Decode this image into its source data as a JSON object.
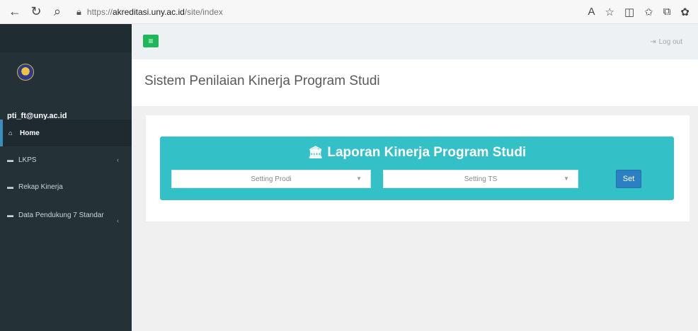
{
  "browser": {
    "url_protocol": "https://",
    "url_host": "akreditasi.uny.ac.id",
    "url_path": "/site/index",
    "icons": [
      "back-arrow-icon",
      "refresh-icon",
      "search-icon",
      "lock-icon",
      "read-aloud-icon",
      "favorite-icon",
      "split-screen-icon",
      "favorites-list-icon",
      "collections-icon",
      "extension-icon"
    ]
  },
  "sidebar": {
    "user_name": "pti_ft@uny.ac.id",
    "items": [
      {
        "label": "Home",
        "icon": "home-icon",
        "active": true
      },
      {
        "label": "LKPS",
        "icon": "briefcase-icon",
        "has_submenu": true
      },
      {
        "label": "Rekap Kinerja",
        "icon": "briefcase-icon"
      },
      {
        "label": "Data Pendukung 7 Standar",
        "icon": "briefcase-icon",
        "has_submenu": true
      }
    ]
  },
  "topbar": {
    "logout_label": "Log out"
  },
  "page": {
    "title": "Sistem Penilaian Kinerja Program Studi"
  },
  "banner": {
    "title": "Laporan Kinerja Program Studi",
    "prodi_placeholder": "Setting Prodi",
    "ts_placeholder": "Setting TS",
    "set_label": "Set"
  },
  "colors": {
    "sidebar_bg": "#243238",
    "banner_bg": "#33c0c7",
    "toggle_green": "#1eb85a",
    "set_blue": "#2d7fc3",
    "active_accent": "#3c8dbc"
  }
}
